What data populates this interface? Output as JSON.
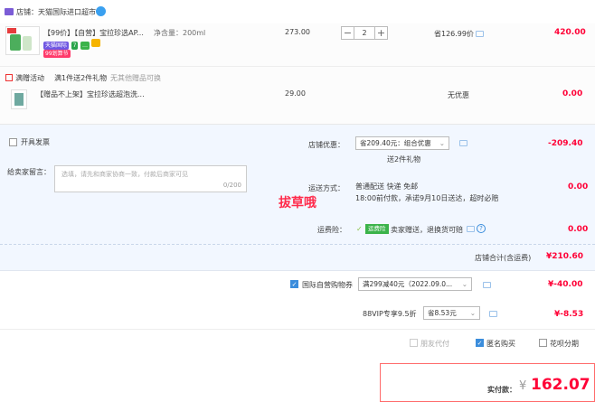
{
  "shop": {
    "name": "店铺：天猫国际进口超市"
  },
  "item": {
    "title": "【99价】【自营】宝拉珍选AP...",
    "spec": "净含量：200ml",
    "price": "273.00",
    "qty": "2",
    "save": "省126.99价",
    "subtotal": "420.00",
    "tags": [
      "天猫国际",
      "7",
      "…",
      "99划算节"
    ]
  },
  "gift": {
    "activity_label": "满赠活动",
    "activity_desc": "满1件送2件礼物",
    "activity_note": "无其他赠品可换",
    "title": "【赠品不上架】宝拉珍选超泡洗...",
    "price": "29.00",
    "promo": "无优惠",
    "subtotal": "0.00"
  },
  "options": {
    "invoice_label": "开具发票",
    "message_label": "给卖家留言：",
    "message_placeholder": "选填，请先和商家协商一致，付款后商家可见",
    "message_count": "0/200",
    "shop_promo_label": "店铺优惠：",
    "shop_promo_value": "省209.40元：组合优惠",
    "shop_promo_sub": "送2件礼物",
    "shop_promo_amount": "-209.40",
    "ship_label": "运送方式：",
    "ship_value": "普通配送 快递 免邮",
    "ship_note": "18:00前付款，承诺9月10日送达，超时必赔",
    "ship_amount": "0.00",
    "freight_label": "运费险：",
    "freight_tag": "运费险",
    "freight_value": "卖家赠送，退换货可赔",
    "freight_amount": "0.00",
    "store_total_label": "店铺合计(含运费)",
    "store_total": "¥210.60"
  },
  "watermark": "拔草哦",
  "coupon": {
    "label": "国际自营购物券",
    "value": "满299减40元（2022.09.0...",
    "amount": "¥-40.00"
  },
  "vip": {
    "label": "88VIP专享9.5折",
    "value": "省8.53元",
    "amount": "¥-8.53"
  },
  "pay_options": {
    "friend": "朋友代付",
    "anonymous": "匿名购买",
    "huabei": "花呗分期"
  },
  "payment": {
    "label": "实付款：",
    "currency": "¥",
    "amount": "162.07"
  }
}
